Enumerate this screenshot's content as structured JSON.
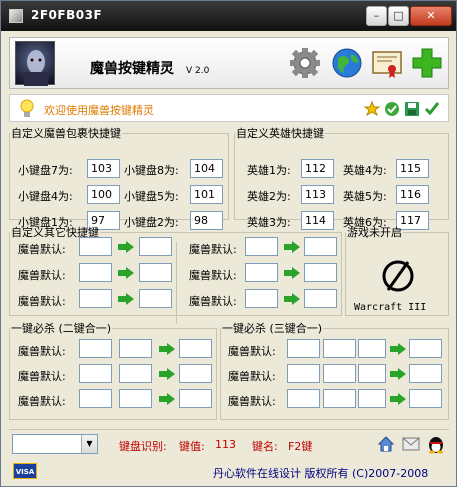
{
  "titlebar": {
    "title": "2F0FB03F",
    "minimize": "–",
    "maximize": "□",
    "close": "✕"
  },
  "header": {
    "app_title": "魔兽按键精灵",
    "version": "V 2.0"
  },
  "tip": {
    "text": "欢迎使用魔兽按键精灵"
  },
  "inventory": {
    "legend": "自定义魔兽包裹快捷键",
    "items": [
      {
        "label": "小键盘7为:",
        "value": "103"
      },
      {
        "label": "小键盘8为:",
        "value": "104"
      },
      {
        "label": "小键盘4为:",
        "value": "100"
      },
      {
        "label": "小键盘5为:",
        "value": "101"
      },
      {
        "label": "小键盘1为:",
        "value": "97"
      },
      {
        "label": "小键盘2为:",
        "value": "98"
      }
    ]
  },
  "heroes": {
    "legend": "自定义英雄快捷键",
    "items": [
      {
        "label": "英雄1为:",
        "value": "112"
      },
      {
        "label": "英雄4为:",
        "value": "115"
      },
      {
        "label": "英雄2为:",
        "value": "113"
      },
      {
        "label": "英雄5为:",
        "value": "116"
      },
      {
        "label": "英雄3为:",
        "value": "114"
      },
      {
        "label": "英雄6为:",
        "value": "117"
      }
    ]
  },
  "other": {
    "legend": "自定义其它快捷键",
    "row_label": "魔兽默认:"
  },
  "game_status": {
    "legend": "游戏未开启",
    "game_name": "Warcraft III"
  },
  "combo2": {
    "legend": "一键必杀 (二键合一)",
    "row_label": "魔兽默认:"
  },
  "combo3": {
    "legend": "一键必杀 (三键合一)",
    "row_label": "魔兽默认:"
  },
  "status": {
    "key_detect": "键盘识别:",
    "key_value_label": "键值:",
    "key_value": "113",
    "key_name_label": "键名:",
    "key_name": "F2键"
  },
  "footer": {
    "visa": "VISA",
    "copyright": "丹心软件在线设计  版权所有 (C)2007-2008"
  },
  "icons": [
    "settings-gear-icon",
    "globe-icon",
    "certificate-icon",
    "add-plus-icon",
    "bulb-icon",
    "star-icon",
    "check-circle-icon",
    "save-disk-icon",
    "check-icon",
    "home-icon",
    "mail-icon",
    "qq-penguin-icon"
  ]
}
